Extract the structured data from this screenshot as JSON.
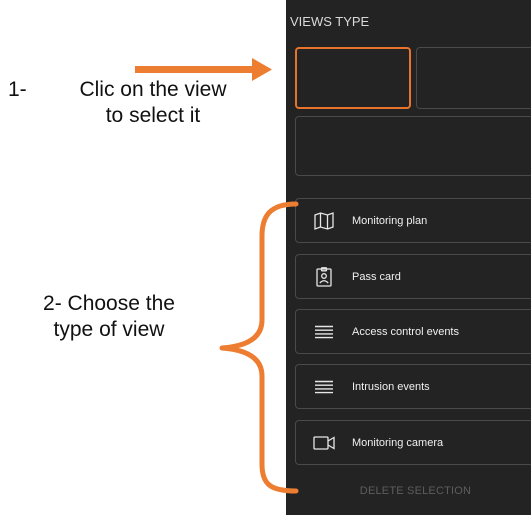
{
  "annotations": {
    "step1_number": "1-",
    "step1_line1": "Clic on the view",
    "step1_line2": "to select it",
    "step2_line1": "2- Choose the",
    "step2_line2": "type of view"
  },
  "panel": {
    "title": "VIEWS TYPE",
    "view_types": [
      {
        "label": "Monitoring plan",
        "icon": "map-icon"
      },
      {
        "label": "Pass card",
        "icon": "badge-icon"
      },
      {
        "label": "Access control events",
        "icon": "list-icon"
      },
      {
        "label": "Intrusion events",
        "icon": "list-icon"
      },
      {
        "label": "Monitoring camera",
        "icon": "camera-icon"
      }
    ],
    "delete_label": "DELETE SELECTION"
  },
  "colors": {
    "panel_bg": "#232323",
    "accent": "#e8732a",
    "annotation_arrow": "#ed7d31"
  }
}
